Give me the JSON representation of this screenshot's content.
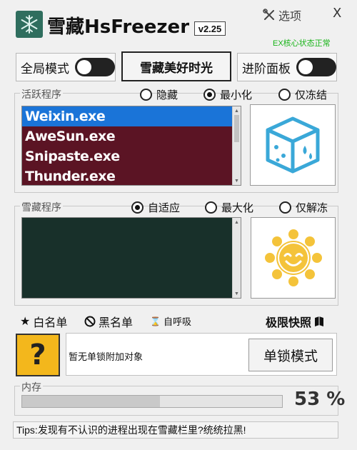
{
  "app": {
    "title": "雪藏HsFreezer",
    "version": "v2.25",
    "options_label": "选项",
    "close_label": "X",
    "status": "EX核心状态正常"
  },
  "controls": {
    "global_mode_label": "全局模式",
    "global_mode_on": false,
    "center_button": "雪藏美好时光",
    "advanced_panel_label": "进阶面板",
    "advanced_panel_on": false
  },
  "active": {
    "group_label": "活跃程序",
    "radios": [
      {
        "label": "隐藏",
        "selected": false
      },
      {
        "label": "最小化",
        "selected": true
      },
      {
        "label": "仅冻结",
        "selected": false
      }
    ],
    "items": [
      "Weixin.exe",
      "AweSun.exe",
      "Snipaste.exe",
      "Thunder.exe"
    ],
    "selected_index": 0,
    "icon": "ice-cube-icon"
  },
  "frozen": {
    "group_label": "雪藏程序",
    "radios": [
      {
        "label": "自适应",
        "selected": true
      },
      {
        "label": "最大化",
        "selected": false
      },
      {
        "label": "仅解冻",
        "selected": false
      }
    ],
    "items": [],
    "icon": "sun-smiley-icon"
  },
  "links": {
    "whitelist": "白名单",
    "blacklist": "黑名单",
    "breathe": "自呼吸",
    "snapshot": "极限快照"
  },
  "lock": {
    "text": "暂无单锁附加对象",
    "button": "单锁模式"
  },
  "memory": {
    "label": "内存",
    "percent_text": "53 %",
    "percent": 53
  },
  "tips": "Tips:发现有不认识的进程出现在雪藏栏里?统统拉黑!",
  "colors": {
    "list_bg_active": "#5b1424",
    "list_bg_frozen": "#18302a",
    "selection": "#1a74d8",
    "status_green": "#18b418",
    "ice_blue": "#3aa8d8",
    "sun_yellow": "#f4c33a"
  }
}
